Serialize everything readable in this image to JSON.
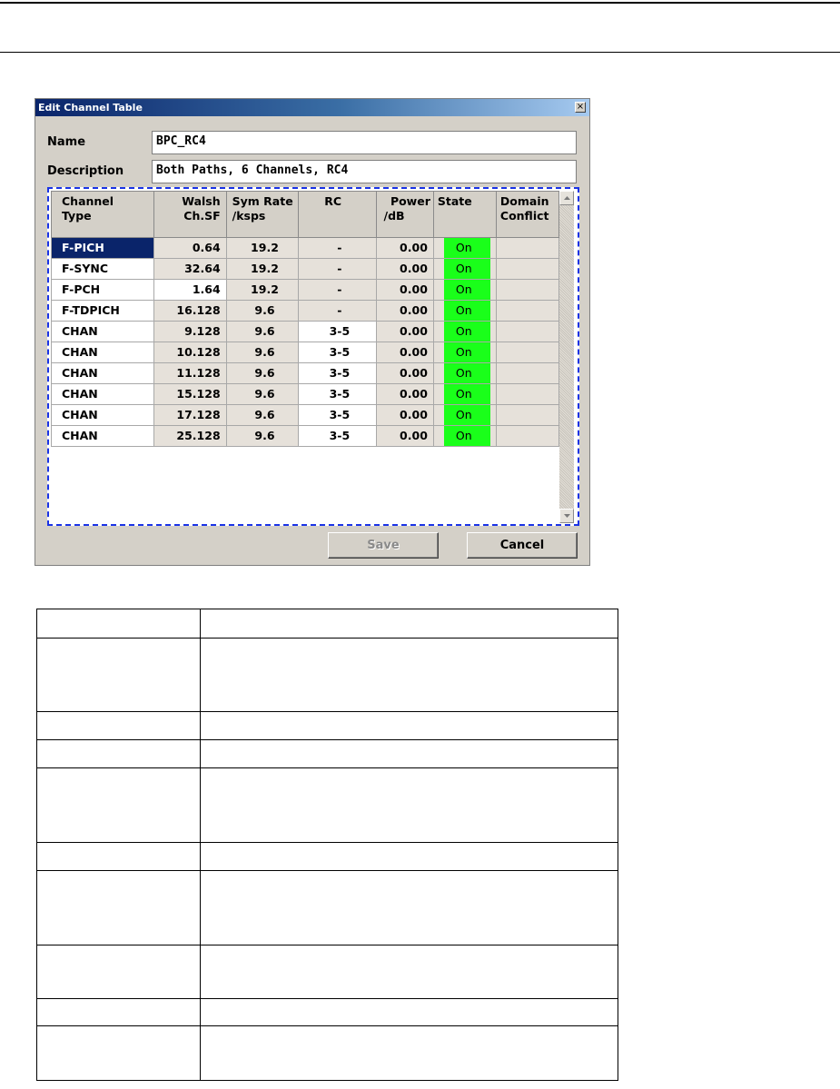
{
  "dialog": {
    "title": "Edit Channel Table",
    "close_glyph": "×",
    "name_label": "Name",
    "name_value": "BPC_RC4",
    "description_label": "Description",
    "description_value": "Both Paths, 6 Channels, RC4",
    "save_label": "Save",
    "cancel_label": "Cancel"
  },
  "table": {
    "headers": {
      "type_1": "Channel",
      "type_2": "Type",
      "walsh_1": "Walsh",
      "walsh_2": "Ch.SF",
      "sym_1": "Sym Rate",
      "sym_2": "/ksps",
      "rc_1": "RC",
      "power_1": "Power",
      "power_2": "/dB",
      "state_1": "State",
      "domain_1": "Domain",
      "domain_2": "Conflict"
    },
    "rows": [
      {
        "type": "F-PICH",
        "walsh": "0.64",
        "sym_rate": "19.2",
        "rc": "-",
        "power": "0.00",
        "state": "On",
        "selected": true
      },
      {
        "type": "F-SYNC",
        "walsh": "32.64",
        "sym_rate": "19.2",
        "rc": "-",
        "power": "0.00",
        "state": "On"
      },
      {
        "type": "F-PCH",
        "walsh": "1.64",
        "sym_rate": "19.2",
        "rc": "-",
        "power": "0.00",
        "state": "On"
      },
      {
        "type": "F-TDPICH",
        "walsh": "16.128",
        "sym_rate": "9.6",
        "rc": "-",
        "power": "0.00",
        "state": "On"
      },
      {
        "type": "CHAN",
        "walsh": "9.128",
        "sym_rate": "9.6",
        "rc": "3-5",
        "power": "0.00",
        "state": "On"
      },
      {
        "type": "CHAN",
        "walsh": "10.128",
        "sym_rate": "9.6",
        "rc": "3-5",
        "power": "0.00",
        "state": "On"
      },
      {
        "type": "CHAN",
        "walsh": "11.128",
        "sym_rate": "9.6",
        "rc": "3-5",
        "power": "0.00",
        "state": "On"
      },
      {
        "type": "CHAN",
        "walsh": "15.128",
        "sym_rate": "9.6",
        "rc": "3-5",
        "power": "0.00",
        "state": "On"
      },
      {
        "type": "CHAN",
        "walsh": "17.128",
        "sym_rate": "9.6",
        "rc": "3-5",
        "power": "0.00",
        "state": "On"
      },
      {
        "type": "CHAN",
        "walsh": "25.128",
        "sym_rate": "9.6",
        "rc": "3-5",
        "power": "0.00",
        "state": "On"
      }
    ]
  },
  "colors": {
    "state_on": "#1aff1a",
    "selection": "#0a246a",
    "focus_border": "#1a33e6"
  },
  "description_table": {
    "rows": [
      "empty-1",
      "empty-2",
      "empty-3",
      "empty-4",
      "empty-5",
      "empty-6",
      "empty-7",
      "empty-8",
      "empty-9",
      "empty-10"
    ]
  }
}
